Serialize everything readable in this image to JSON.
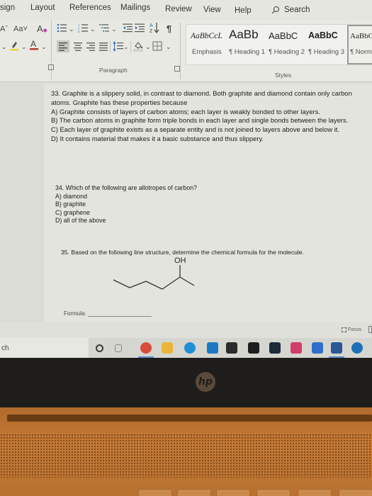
{
  "ribbon": {
    "tabs": [
      "sign",
      "Layout",
      "References",
      "Mailings",
      "Review",
      "View",
      "Help"
    ],
    "search_label": "Search",
    "font_controls": {
      "grow_font": "Aˆ",
      "change_case": "Aa˅",
      "clear_format": "A"
    },
    "styles": [
      {
        "sample": "AaBbCcL",
        "name": "Emphasis"
      },
      {
        "sample": "AaBb",
        "name": "¶ Heading 1"
      },
      {
        "sample": "AaBbC",
        "name": "¶ Heading 2"
      },
      {
        "sample": "AaBbC",
        "name": "¶ Heading 3"
      },
      {
        "sample": "AaBbC",
        "name": "¶ Norma"
      }
    ],
    "group_labels": {
      "paragraph": "Paragraph",
      "styles": "Styles"
    },
    "icons": [
      "bullets-icon",
      "numbering-icon",
      "multilevel-list-icon",
      "decrease-indent-icon",
      "increase-indent-icon",
      "sort-icon",
      "pilcrow-icon",
      "highlight-icon",
      "font-color-icon",
      "align-left-icon",
      "align-center-icon",
      "align-right-icon",
      "justify-icon",
      "line-spacing-icon",
      "shading-icon",
      "borders-icon"
    ],
    "colors": {
      "highlight": "#e6d53a",
      "font_color": "#c0392b"
    }
  },
  "document": {
    "q33": {
      "stem": "33. Graphite is a slippery solid, in contrast to diamond. Both graphite and diamond contain only carbon atoms. Graphite has these properties because",
      "options": [
        "A) Graphite consists of layers of carbon atoms; each layer is weakly bonded to other layers.",
        "B) The carbon atoms in graphite form triple bonds in each layer and single bonds between the layers.",
        "C) Each layer of graphite exists as a separate entity and is not joined to layers above and below it.",
        "D) It contains material that makes it a basic substance and thus slippery."
      ]
    },
    "q34": {
      "stem": "34. Which of the following are allotropes of carbon?",
      "options": [
        "A) diamond",
        "B) graphite",
        "C) graphene",
        "D) all of the above"
      ]
    },
    "q35": {
      "stem": "35. Based on the following line structure, determine the chemical formula for the molecule.",
      "molecule_label": "OH",
      "formula_label": "Formula:",
      "formula_value": ""
    }
  },
  "statusbar": {
    "focus_label": "Focus"
  },
  "taskbar": {
    "search_text": "ch",
    "apps": [
      {
        "name": "cortana-icon",
        "color": "#3a3a3a"
      },
      {
        "name": "task-view-icon",
        "color": "#888888"
      },
      {
        "name": "chrome-icon",
        "color": "#d94b3b"
      },
      {
        "name": "file-explorer-icon",
        "color": "#e9b63a"
      },
      {
        "name": "edge-icon",
        "color": "#1f8fd6"
      },
      {
        "name": "mail-icon",
        "color": "#1a78c2"
      },
      {
        "name": "store-icon",
        "color": "#2b2b2b"
      },
      {
        "name": "dropbox-icon",
        "color": "#1e1e1e"
      },
      {
        "name": "scrivener-icon",
        "color": "#1c2a3a"
      },
      {
        "name": "pandora-icon",
        "color": "#d23d6b"
      },
      {
        "name": "calendar-icon",
        "color": "#2f6fc9"
      },
      {
        "name": "word-icon",
        "color": "#2b5797"
      },
      {
        "name": "help-icon",
        "color": "#1e6fb8"
      }
    ]
  },
  "device": {
    "brand_logo": "hp"
  }
}
